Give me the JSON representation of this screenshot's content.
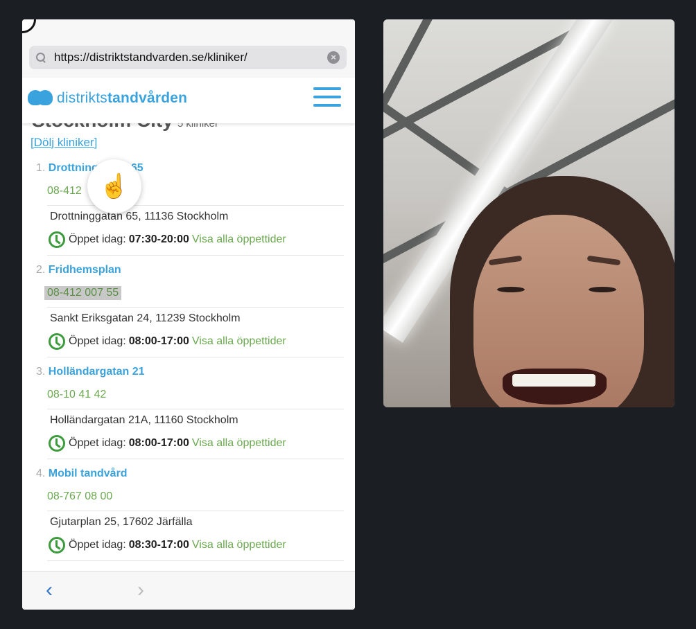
{
  "browser": {
    "url": "https://distriktstandvarden.se/kliniker/",
    "nav_back": "‹",
    "nav_forward": "›"
  },
  "site": {
    "logo_light": "distrikts",
    "logo_bold": "tandvården",
    "region_title": "Stockholm City",
    "region_count": "5 kliniker",
    "hide_link": "[Dölj kliniker]"
  },
  "clinics": [
    {
      "number": "1.",
      "name": "Drottninggatan 65",
      "phone": "08-412",
      "address": "Drottninggatan 65, 11136 Stockholm",
      "open_label": "Öppet idag:",
      "hours": "07:30-20:00",
      "all_hours": "Visa alla öppettider"
    },
    {
      "number": "2.",
      "name": "Fridhemsplan",
      "phone": "08-412 007 55",
      "address": "Sankt Eriksgatan 24, 11239 Stockholm",
      "open_label": "Öppet idag:",
      "hours": "08:00-17:00",
      "all_hours": "Visa alla öppettider"
    },
    {
      "number": "3.",
      "name": "Holländargatan 21",
      "phone": "08-10 41 42",
      "address": "Holländargatan 21A, 11160 Stockholm",
      "open_label": "Öppet idag:",
      "hours": "08:00-17:00",
      "all_hours": "Visa alla öppettider"
    },
    {
      "number": "4.",
      "name": "Mobil tandvård",
      "phone": "08-767 08 00",
      "address": "Gjutarplan 25, 17602 Järfälla",
      "open_label": "Öppet idag:",
      "hours": "08:30-17:00",
      "all_hours": "Visa alla öppettider"
    }
  ],
  "icons": {
    "search": "search-icon",
    "clear": "clear-icon",
    "menu": "hamburger-menu-icon",
    "clock": "clock-icon",
    "tap": "tap-hand-icon"
  },
  "colors": {
    "brand_blue": "#3aa2dc",
    "phone_green": "#6aa84f",
    "clock_green": "#3c9b3c",
    "background": "#1b1f24"
  }
}
